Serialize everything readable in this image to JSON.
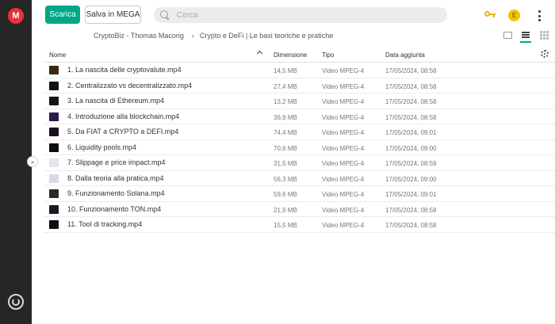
{
  "header": {
    "download_label": "Scarica",
    "save_label": "Salva in MEGA",
    "search_placeholder": "Cerca",
    "avatar_initial": "E",
    "logo_letter": "M"
  },
  "breadcrumb": {
    "root": "CryptoBiz - Thomas Macorig",
    "current": "Crypto e DeFi | Le basi teoriche e pratiche"
  },
  "table": {
    "columns": {
      "name": "Nome",
      "size": "Dimensione",
      "type": "Tipo",
      "date": "Data aggiunta"
    },
    "rows": [
      {
        "name": "1. La nascita delle cryptovalute.mp4",
        "size": "14,5 MB",
        "type": "Video MPEG-4",
        "date": "17/05/2024, 08:58",
        "thumb_color": "#3a2a10"
      },
      {
        "name": "2. Centralizzato vs decentralizzato.mp4",
        "size": "27,4 MB",
        "type": "Video MPEG-4",
        "date": "17/05/2024, 08:58",
        "thumb_color": "#111111"
      },
      {
        "name": "3. La nascita di Ethereum.mp4",
        "size": "13,2 MB",
        "type": "Video MPEG-4",
        "date": "17/05/2024, 08:58",
        "thumb_color": "#151515"
      },
      {
        "name": "4. Introduzione alla blockchain.mp4",
        "size": "36,9 MB",
        "type": "Video MPEG-4",
        "date": "17/05/2024, 08:58",
        "thumb_color": "#2a1a4a"
      },
      {
        "name": "5. Da FIAT a CRYPTO a DEFI.mp4",
        "size": "74,4 MB",
        "type": "Video MPEG-4",
        "date": "17/05/2024, 09:01",
        "thumb_color": "#1a1020"
      },
      {
        "name": "6. Liquidity pools.mp4",
        "size": "70,6 MB",
        "type": "Video MPEG-4",
        "date": "17/05/2024, 09:00",
        "thumb_color": "#120c08"
      },
      {
        "name": "7. Slippage e price impact.mp4",
        "size": "31,5 MB",
        "type": "Video MPEG-4",
        "date": "17/05/2024, 08:59",
        "thumb_color": "#e4e4ea"
      },
      {
        "name": "8. Dalla teoria alla pratica.mp4",
        "size": "56,3 MB",
        "type": "Video MPEG-4",
        "date": "17/05/2024, 09:00",
        "thumb_color": "#d8d8e8"
      },
      {
        "name": "9. Funzionamento Solana.mp4",
        "size": "59,6 MB",
        "type": "Video MPEG-4",
        "date": "17/05/2024, 09:01",
        "thumb_color": "#2a2a2a"
      },
      {
        "name": "10. Funzionamento TON.mp4",
        "size": "21,9 MB",
        "type": "Video MPEG-4",
        "date": "17/05/2024, 08:58",
        "thumb_color": "#1a1a24"
      },
      {
        "name": "11. Tool di tracking.mp4",
        "size": "15,5 MB",
        "type": "Video MPEG-4",
        "date": "17/05/2024, 08:58",
        "thumb_color": "#0e0e12"
      }
    ]
  },
  "colors": {
    "accent": "#00a886",
    "brand": "#e9313d",
    "rail": "#262626"
  },
  "icons": [
    "mega-logo-icon",
    "search-icon",
    "key-icon",
    "kebab-menu-icon",
    "thumbnail-view-icon",
    "list-view-icon",
    "grid-view-icon",
    "sort-up-icon",
    "gear-icon",
    "expand-sidebar-icon",
    "transfers-icon"
  ]
}
